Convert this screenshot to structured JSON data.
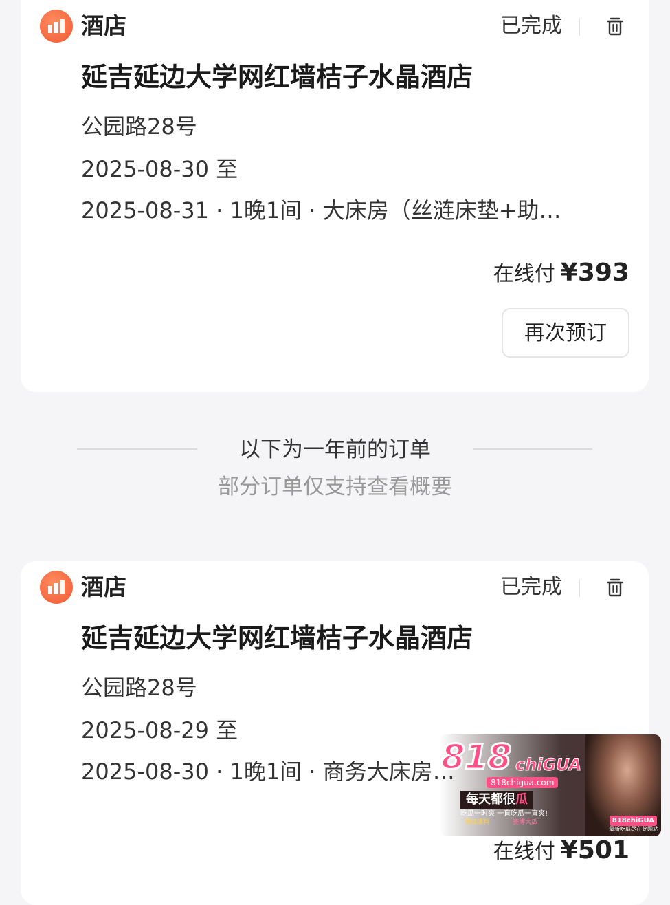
{
  "orders": [
    {
      "category": "酒店",
      "status": "已完成",
      "hotel_name": "延吉延边大学网红墙桔子水晶酒店",
      "address": "公园路28号",
      "date_line_1": "2025-08-30 至",
      "date_line_2": "2025-08-31 · 1晚1间 · 大床房（丝涟床垫+助…",
      "price_label": "在线付",
      "price_amount": "¥393",
      "rebook_label": "再次预订"
    },
    {
      "category": "酒店",
      "status": "已完成",
      "hotel_name": "延吉延边大学网红墙桔子水晶酒店",
      "address": "公园路28号",
      "date_line_1": "2025-08-29 至",
      "date_line_2": "2025-08-30 · 1晚1间 · 商务大床房…",
      "price_label": "在线付",
      "price_amount": "¥501"
    }
  ],
  "divider": {
    "title": "以下为一年前的订单",
    "subtitle": "部分订单仅支持查看概要"
  },
  "watermark": {
    "logo": "818",
    "logo_sub": "chiGUA",
    "url": "818chigua.com",
    "slogan_prefix": "每天都很",
    "slogan_highlight": "瓜",
    "tagline": "吃瓜一时爽 一直吃瓜一直爽!",
    "badge_left": "顶级爆料",
    "badge_right": "赛博大瓜",
    "corner": "818chiGUA",
    "corner_sub": "最新吃瓜尽在此网站"
  },
  "colors": {
    "brand_orange": "#f05a35",
    "watermark_pink": "#ff4f86",
    "background": "#f5f5f7"
  },
  "icons": {
    "hotel": "hotel-icon",
    "delete": "trash-icon"
  }
}
